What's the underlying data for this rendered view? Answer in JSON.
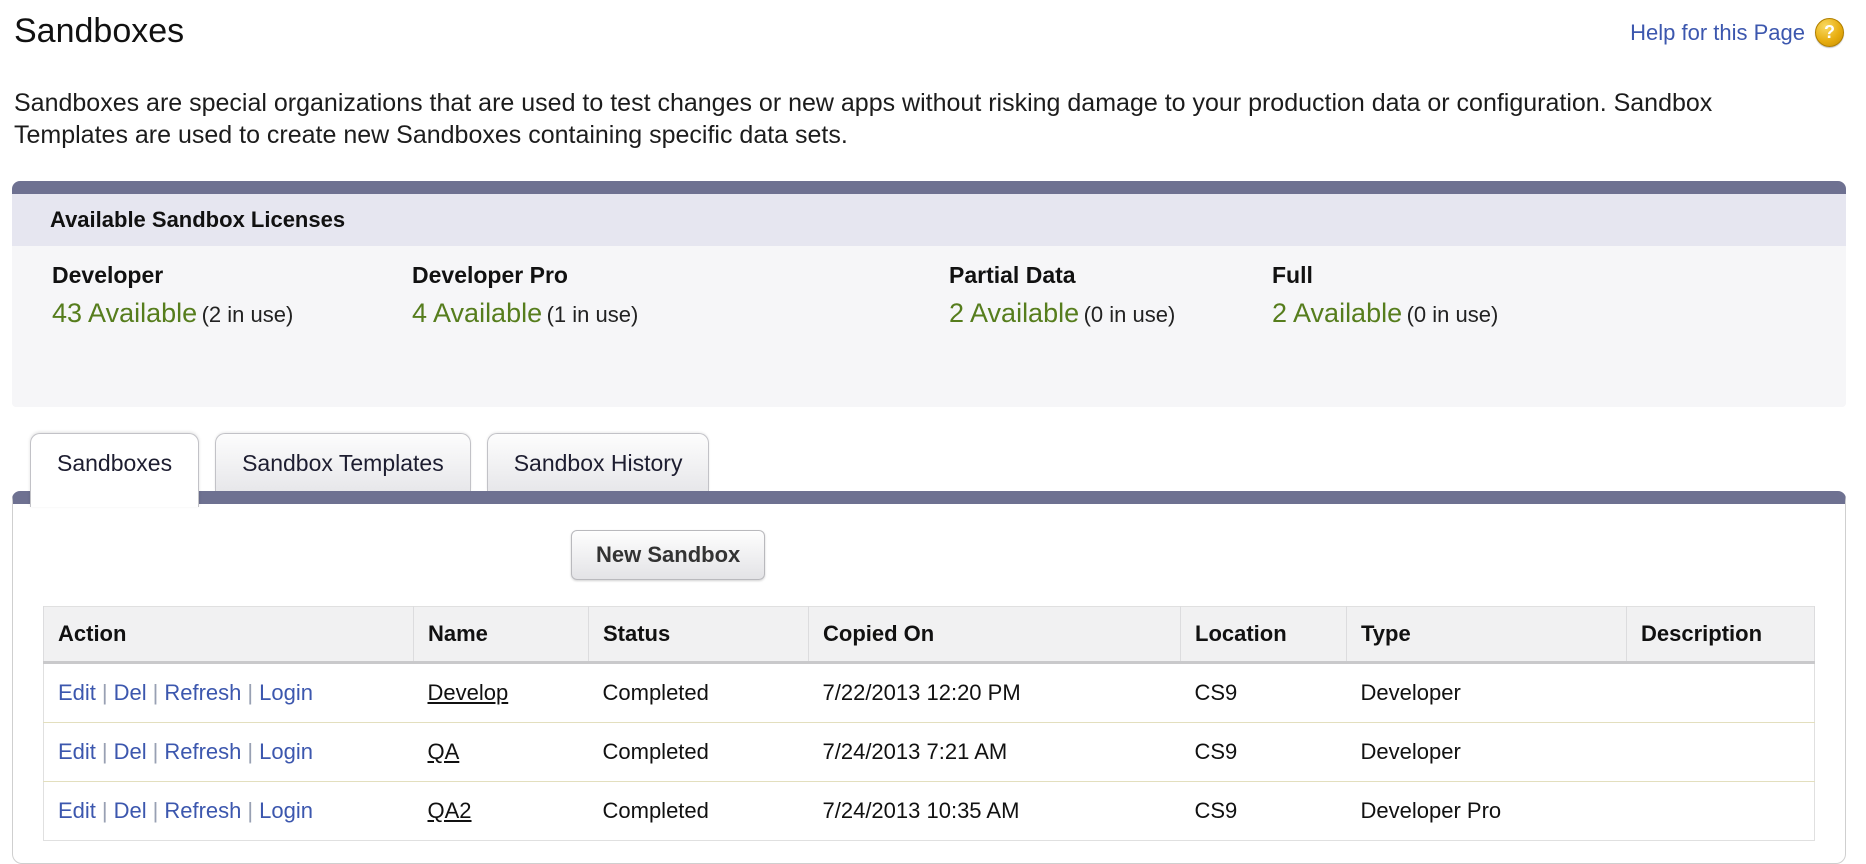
{
  "page": {
    "title": "Sandboxes",
    "help_link": "Help for this Page",
    "help_icon_glyph": "?",
    "description": "Sandboxes are special organizations that are used to test changes or new apps without risking damage to your production data or configuration. Sandbox Templates are used to create new Sandboxes containing specific data sets."
  },
  "licenses": {
    "header": "Available Sandbox Licenses",
    "items": [
      {
        "name": "Developer",
        "available": "43 Available",
        "in_use": "(2 in use)"
      },
      {
        "name": "Developer Pro",
        "available": "4 Available",
        "in_use": "(1 in use)"
      },
      {
        "name": "Partial Data",
        "available": "2 Available",
        "in_use": "(0 in use)"
      },
      {
        "name": "Full",
        "available": "2 Available",
        "in_use": "(0 in use)"
      }
    ]
  },
  "tabs": [
    {
      "label": "Sandboxes",
      "active": true
    },
    {
      "label": "Sandbox Templates",
      "active": false
    },
    {
      "label": "Sandbox History",
      "active": false
    }
  ],
  "toolbar": {
    "new_sandbox_label": "New Sandbox"
  },
  "table": {
    "columns": [
      "Action",
      "Name",
      "Status",
      "Copied On",
      "Location",
      "Type",
      "Description"
    ],
    "action_links": [
      "Edit",
      "Del",
      "Refresh",
      "Login"
    ],
    "rows": [
      {
        "name": "Develop",
        "status": "Completed",
        "copied_on": "7/22/2013 12:20 PM",
        "location": "CS9",
        "type": "Developer",
        "description": ""
      },
      {
        "name": "QA",
        "status": "Completed",
        "copied_on": "7/24/2013 7:21 AM",
        "location": "CS9",
        "type": "Developer",
        "description": ""
      },
      {
        "name": "QA2",
        "status": "Completed",
        "copied_on": "7/24/2013 10:35 AM",
        "location": "CS9",
        "type": "Developer Pro",
        "description": ""
      }
    ]
  },
  "colors": {
    "link_blue": "#3c57ae",
    "available_green": "#567d1d",
    "slate_bar": "#6e7191",
    "section_header_lavender": "#e6e6f0",
    "help_icon_gold": "#d9a300",
    "row_separator_khaki": "#e3dfbe"
  }
}
